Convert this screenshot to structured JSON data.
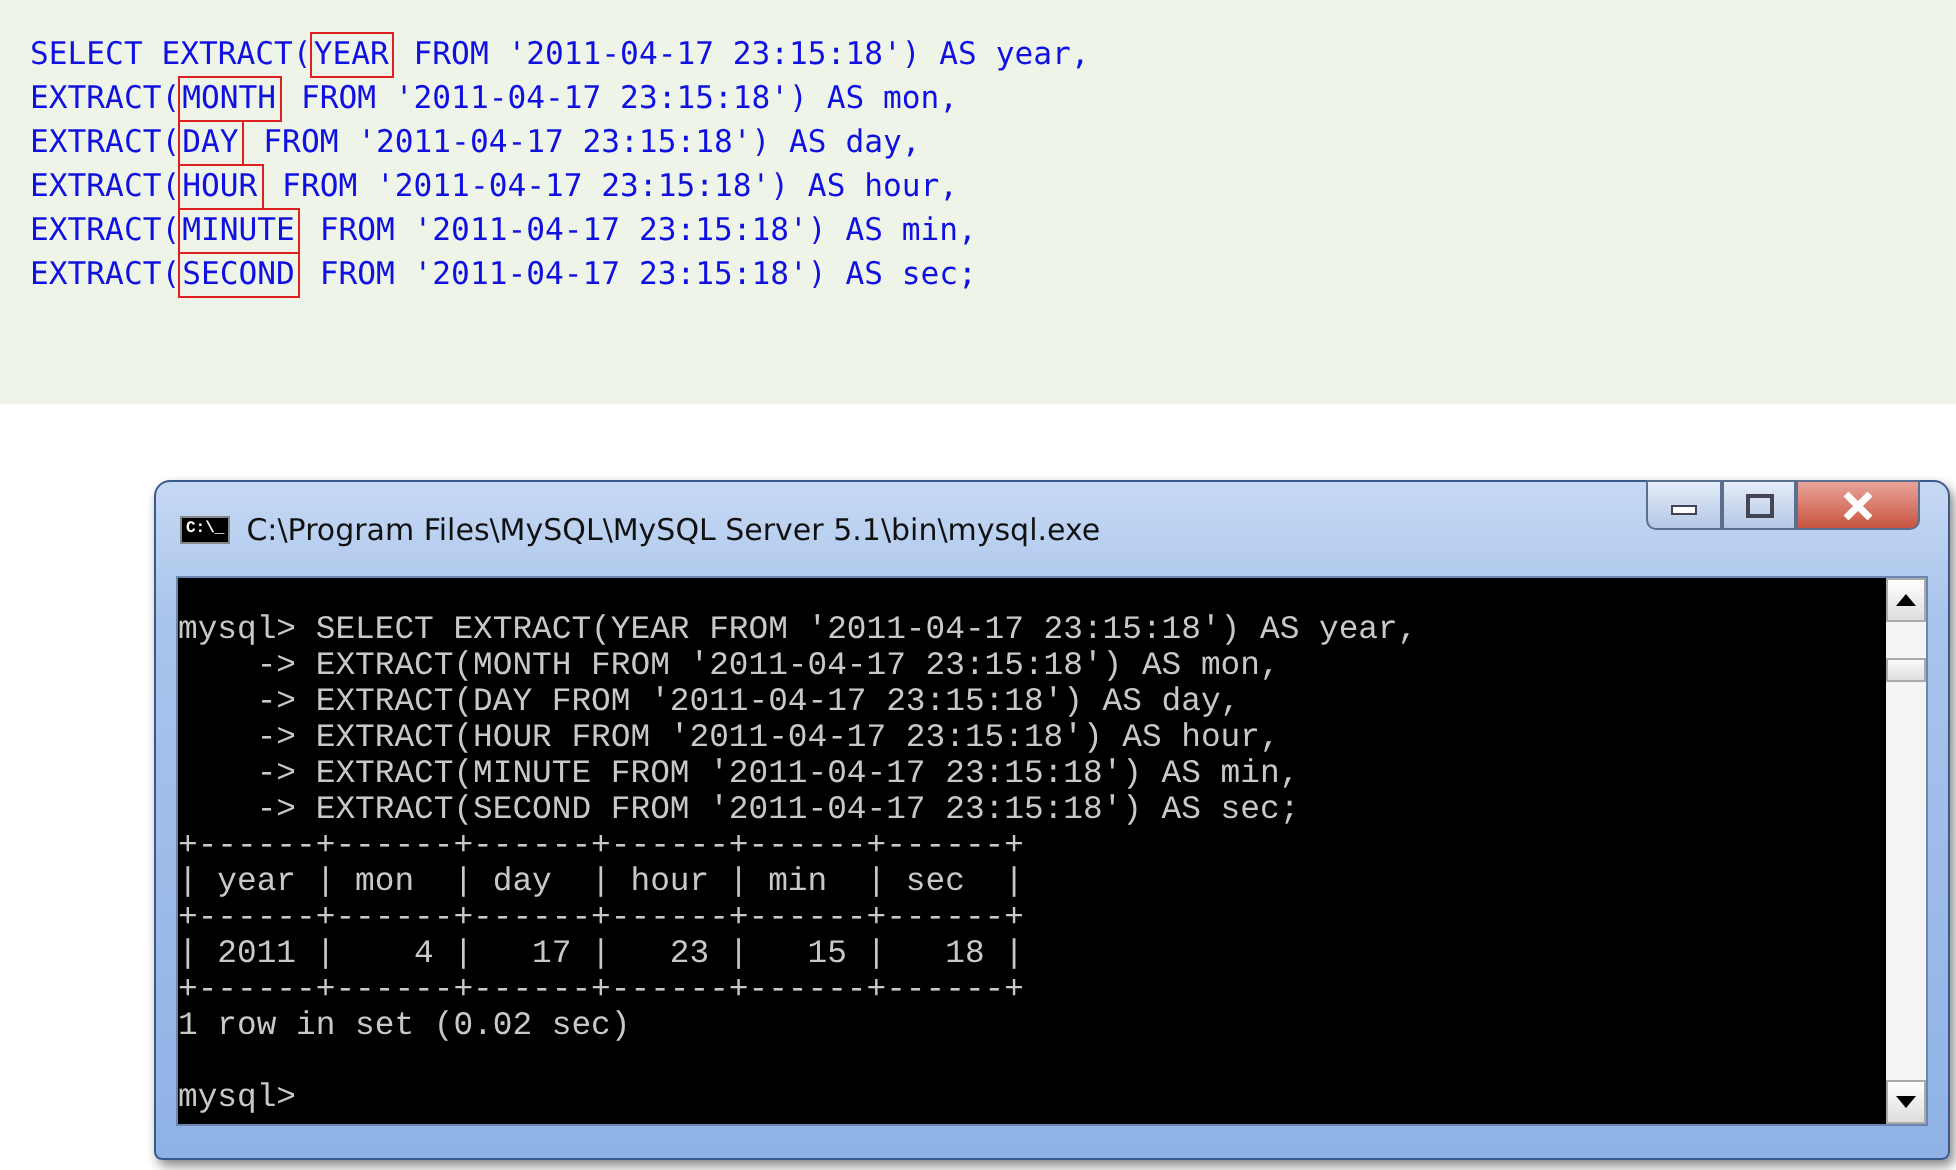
{
  "code_block": {
    "lines": [
      {
        "before": "SELECT EXTRACT(",
        "keyword": "YEAR",
        "after": " FROM '2011-04-17 23:15:18') AS year,"
      },
      {
        "before": "EXTRACT(",
        "keyword": "MONTH",
        "after": " FROM '2011-04-17 23:15:18') AS mon,"
      },
      {
        "before": "EXTRACT(",
        "keyword": "DAY",
        "after": " FROM '2011-04-17 23:15:18') AS day,"
      },
      {
        "before": "EXTRACT(",
        "keyword": "HOUR",
        "after": " FROM '2011-04-17 23:15:18') AS hour,"
      },
      {
        "before": "EXTRACT(",
        "keyword": "MINUTE",
        "after": " FROM '2011-04-17 23:15:18') AS min,"
      },
      {
        "before": "EXTRACT(",
        "keyword": "SECOND",
        "after": " FROM '2011-04-17 23:15:18') AS sec;"
      }
    ]
  },
  "console_window": {
    "title": "C:\\Program Files\\MySQL\\MySQL Server 5.1\\bin\\mysql.exe",
    "icon_text": "C:\\_",
    "lines": [
      "mysql> SELECT EXTRACT(YEAR FROM '2011-04-17 23:15:18') AS year,",
      "    -> EXTRACT(MONTH FROM '2011-04-17 23:15:18') AS mon,",
      "    -> EXTRACT(DAY FROM '2011-04-17 23:15:18') AS day,",
      "    -> EXTRACT(HOUR FROM '2011-04-17 23:15:18') AS hour,",
      "    -> EXTRACT(MINUTE FROM '2011-04-17 23:15:18') AS min,",
      "    -> EXTRACT(SECOND FROM '2011-04-17 23:15:18') AS sec;",
      "+------+------+------+------+------+------+",
      "| year | mon  | day  | hour | min  | sec  |",
      "+------+------+------+------+------+------+",
      "| 2011 |    4 |   17 |   23 |   15 |   18 |",
      "+------+------+------+------+------+------+",
      "1 row in set (0.02 sec)"
    ],
    "prompt": "mysql>"
  }
}
